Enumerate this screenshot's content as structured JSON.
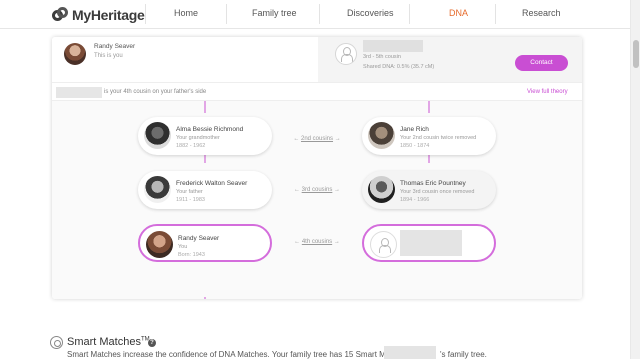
{
  "nav": {
    "logo": "MyHeritage",
    "items": [
      {
        "label": "Home"
      },
      {
        "label": "Family tree"
      },
      {
        "label": "Discoveries"
      },
      {
        "label": "DNA"
      },
      {
        "label": "Research"
      }
    ],
    "active_color": "#e66b2c"
  },
  "header": {
    "me_name": "Randy Seaver",
    "me_sub": "This is you",
    "match_relationship": "3rd - 5th cousin",
    "match_shared": "Shared DNA: 0.5% (35.7 cM)",
    "contact_label": "Contact"
  },
  "info": {
    "text": "is your 4th cousin on your father's side",
    "link": "View full theory"
  },
  "tree": {
    "left": [
      {
        "name": "Alma Bessie Richmond",
        "role": "Your grandmother",
        "dates": "1882 - 1962"
      },
      {
        "name": "Frederick Walton Seaver",
        "role": "Your father",
        "dates": "1911 - 1983"
      },
      {
        "name": "Randy Seaver",
        "role": "You",
        "dates": "Born: 1943"
      }
    ],
    "right": [
      {
        "name": "Jane Rich",
        "role": "Your 2nd cousin twice removed",
        "dates": "1850 - 1874"
      },
      {
        "name": "Thomas Eric Pountney",
        "role": "Your 3rd cousin once removed",
        "dates": "1894 - 1966"
      },
      {
        "name": "",
        "role": "",
        "dates": ""
      }
    ],
    "relations": [
      "2nd cousins",
      "3rd cousins",
      "4th cousins"
    ],
    "accent": "#d46ddc"
  },
  "smart_matches": {
    "title": "Smart Matches",
    "tm": "TM",
    "help": "?",
    "description": "Smart Matches increase the confidence of DNA Matches. Your family tree has 15 Smart Matches with",
    "description_end": "'s family tree."
  }
}
